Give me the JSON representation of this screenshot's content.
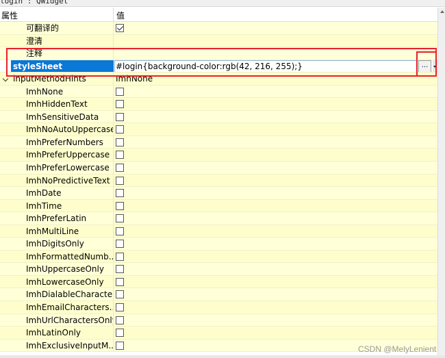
{
  "window": {
    "title": "login : QWidget"
  },
  "header": {
    "col_property": "属性",
    "col_value": "值"
  },
  "rows": [
    {
      "name": "可翻译的",
      "value_type": "checkbox",
      "checked": true
    },
    {
      "name": "澄清",
      "value_type": "text",
      "value": ""
    },
    {
      "name": "注释",
      "value_type": "text",
      "value": ""
    },
    {
      "name": "styleSheet",
      "value_type": "editor",
      "value": "#login{background-color:rgb(42, 216, 255);}",
      "button_label": "..."
    },
    {
      "name": "inputMethodHints",
      "value_type": "text",
      "value": "ImhNone",
      "expanded": true
    },
    {
      "name": "ImhNone",
      "value_type": "checkbox",
      "checked": false
    },
    {
      "name": "ImhHiddenText",
      "value_type": "checkbox",
      "checked": false
    },
    {
      "name": "ImhSensitiveData",
      "value_type": "checkbox",
      "checked": false
    },
    {
      "name": "ImhNoAutoUppercase",
      "value_type": "checkbox",
      "checked": false
    },
    {
      "name": "ImhPreferNumbers",
      "value_type": "checkbox",
      "checked": false
    },
    {
      "name": "ImhPreferUppercase",
      "value_type": "checkbox",
      "checked": false
    },
    {
      "name": "ImhPreferLowercase",
      "value_type": "checkbox",
      "checked": false
    },
    {
      "name": "ImhNoPredictiveText",
      "value_type": "checkbox",
      "checked": false
    },
    {
      "name": "ImhDate",
      "value_type": "checkbox",
      "checked": false
    },
    {
      "name": "ImhTime",
      "value_type": "checkbox",
      "checked": false
    },
    {
      "name": "ImhPreferLatin",
      "value_type": "checkbox",
      "checked": false
    },
    {
      "name": "ImhMultiLine",
      "value_type": "checkbox",
      "checked": false
    },
    {
      "name": "ImhDigitsOnly",
      "value_type": "checkbox",
      "checked": false
    },
    {
      "name": "ImhFormattedNumb...",
      "value_type": "checkbox",
      "checked": false
    },
    {
      "name": "ImhUppercaseOnly",
      "value_type": "checkbox",
      "checked": false
    },
    {
      "name": "ImhLowercaseOnly",
      "value_type": "checkbox",
      "checked": false
    },
    {
      "name": "ImhDialableCharacte...",
      "value_type": "checkbox",
      "checked": false
    },
    {
      "name": "ImhEmailCharacters...",
      "value_type": "checkbox",
      "checked": false
    },
    {
      "name": "ImhUrlCharactersOnly",
      "value_type": "checkbox",
      "checked": false
    },
    {
      "name": "ImhLatinOnly",
      "value_type": "checkbox",
      "checked": false
    },
    {
      "name": "ImhExclusiveInputM...",
      "value_type": "checkbox",
      "checked": false
    }
  ],
  "watermark": "CSDN @MelyLenient",
  "colors": {
    "row_bg": "#ffffd8",
    "selection": "#0a78d7",
    "highlight_box": "#e6202a"
  }
}
